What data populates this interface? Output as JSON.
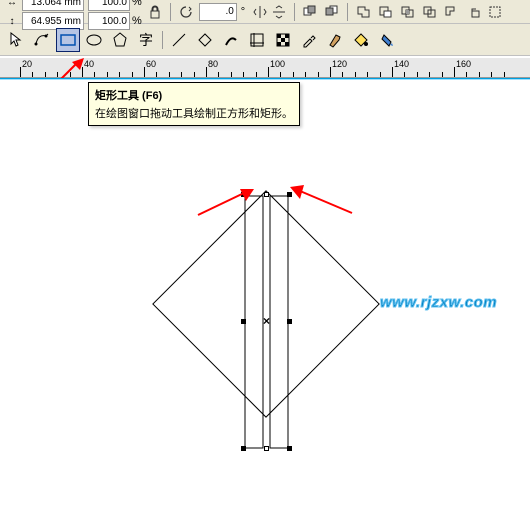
{
  "props": {
    "width_icon": "↔",
    "height_icon": "↕",
    "width": "13.064 mm",
    "height": "64.955 mm",
    "scale_x": "100.0",
    "scale_y": "100.0",
    "pct": "%",
    "rotation": ".0",
    "deg": "°"
  },
  "tooltip": {
    "title": "矩形工具 (F6)",
    "desc": "在绘图窗口拖动工具绘制正方形和矩形。"
  },
  "ruler": {
    "ticks": [
      20,
      40,
      60,
      80,
      100,
      120,
      140,
      160
    ]
  },
  "watermark": "www.rjzxw.com",
  "center_mark": "×"
}
